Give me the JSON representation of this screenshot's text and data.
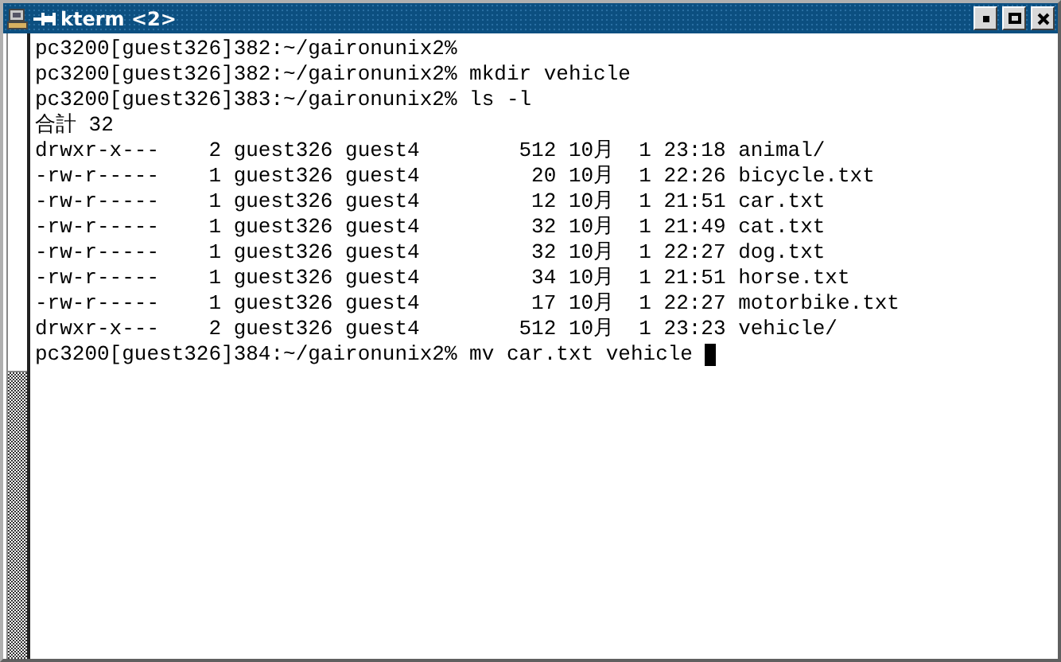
{
  "window": {
    "title": "kterm <2>"
  },
  "terminal": {
    "cursor": true,
    "lines": [
      "pc3200[guest326]382:~/gaironunix2%",
      "pc3200[guest326]382:~/gaironunix2% mkdir vehicle",
      "pc3200[guest326]383:~/gaironunix2% ls -l",
      "合計 32",
      "drwxr-x---    2 guest326 guest4        512 10月  1 23:18 animal/",
      "-rw-r-----    1 guest326 guest4         20 10月  1 22:26 bicycle.txt",
      "-rw-r-----    1 guest326 guest4         12 10月  1 21:51 car.txt",
      "-rw-r-----    1 guest326 guest4         32 10月  1 21:49 cat.txt",
      "-rw-r-----    1 guest326 guest4         32 10月  1 22:27 dog.txt",
      "-rw-r-----    1 guest326 guest4         34 10月  1 21:51 horse.txt",
      "-rw-r-----    1 guest326 guest4         17 10月  1 22:27 motorbike.txt",
      "drwxr-x---    2 guest326 guest4        512 10月  1 23:23 vehicle/",
      "pc3200[guest326]384:~/gaironunix2% mv car.txt vehicle "
    ]
  }
}
